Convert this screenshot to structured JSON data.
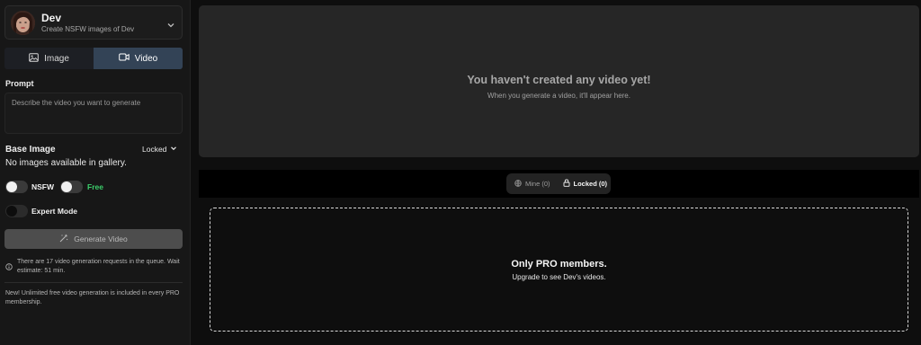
{
  "character": {
    "name": "Dev",
    "subtitle": "Create NSFW images of Dev"
  },
  "mode_tabs": [
    {
      "label": "Image",
      "icon": "image-icon",
      "active": false
    },
    {
      "label": "Video",
      "icon": "video-camera-icon",
      "active": true
    }
  ],
  "prompt": {
    "label": "Prompt",
    "placeholder": "Describe the video you want to generate",
    "value": ""
  },
  "base_image": {
    "label": "Base Image",
    "dropdown_value": "Locked",
    "empty_text": "No images available in gallery."
  },
  "toggles": {
    "nsfw_label": "NSFW",
    "free_label": "Free",
    "expert_label": "Expert Mode"
  },
  "generate_button": {
    "label": "Generate Video",
    "icon": "magic-wand-icon"
  },
  "queue_notice": "There are 17 video generation requests in the queue. Wait estimate: 51 min.",
  "promo_notice": "New! Unlimited free video generation is included in every PRO membership.",
  "empty_state": {
    "title": "You haven't created any video yet!",
    "subtitle": "When you generate a video, it'll appear here."
  },
  "filter_tabs": [
    {
      "label": "Mine (0)",
      "icon": "globe-icon",
      "active": false
    },
    {
      "label": "Locked (0)",
      "icon": "lock-icon",
      "active": true
    }
  ],
  "pro_gate": {
    "title": "Only PRO members.",
    "subtitle": "Upgrade to see Dev's videos."
  },
  "colors": {
    "sidebar_bg": "#171717",
    "active_tab_bg": "#334356",
    "free_green": "#3ccf6b",
    "panel_bg": "#262626"
  }
}
